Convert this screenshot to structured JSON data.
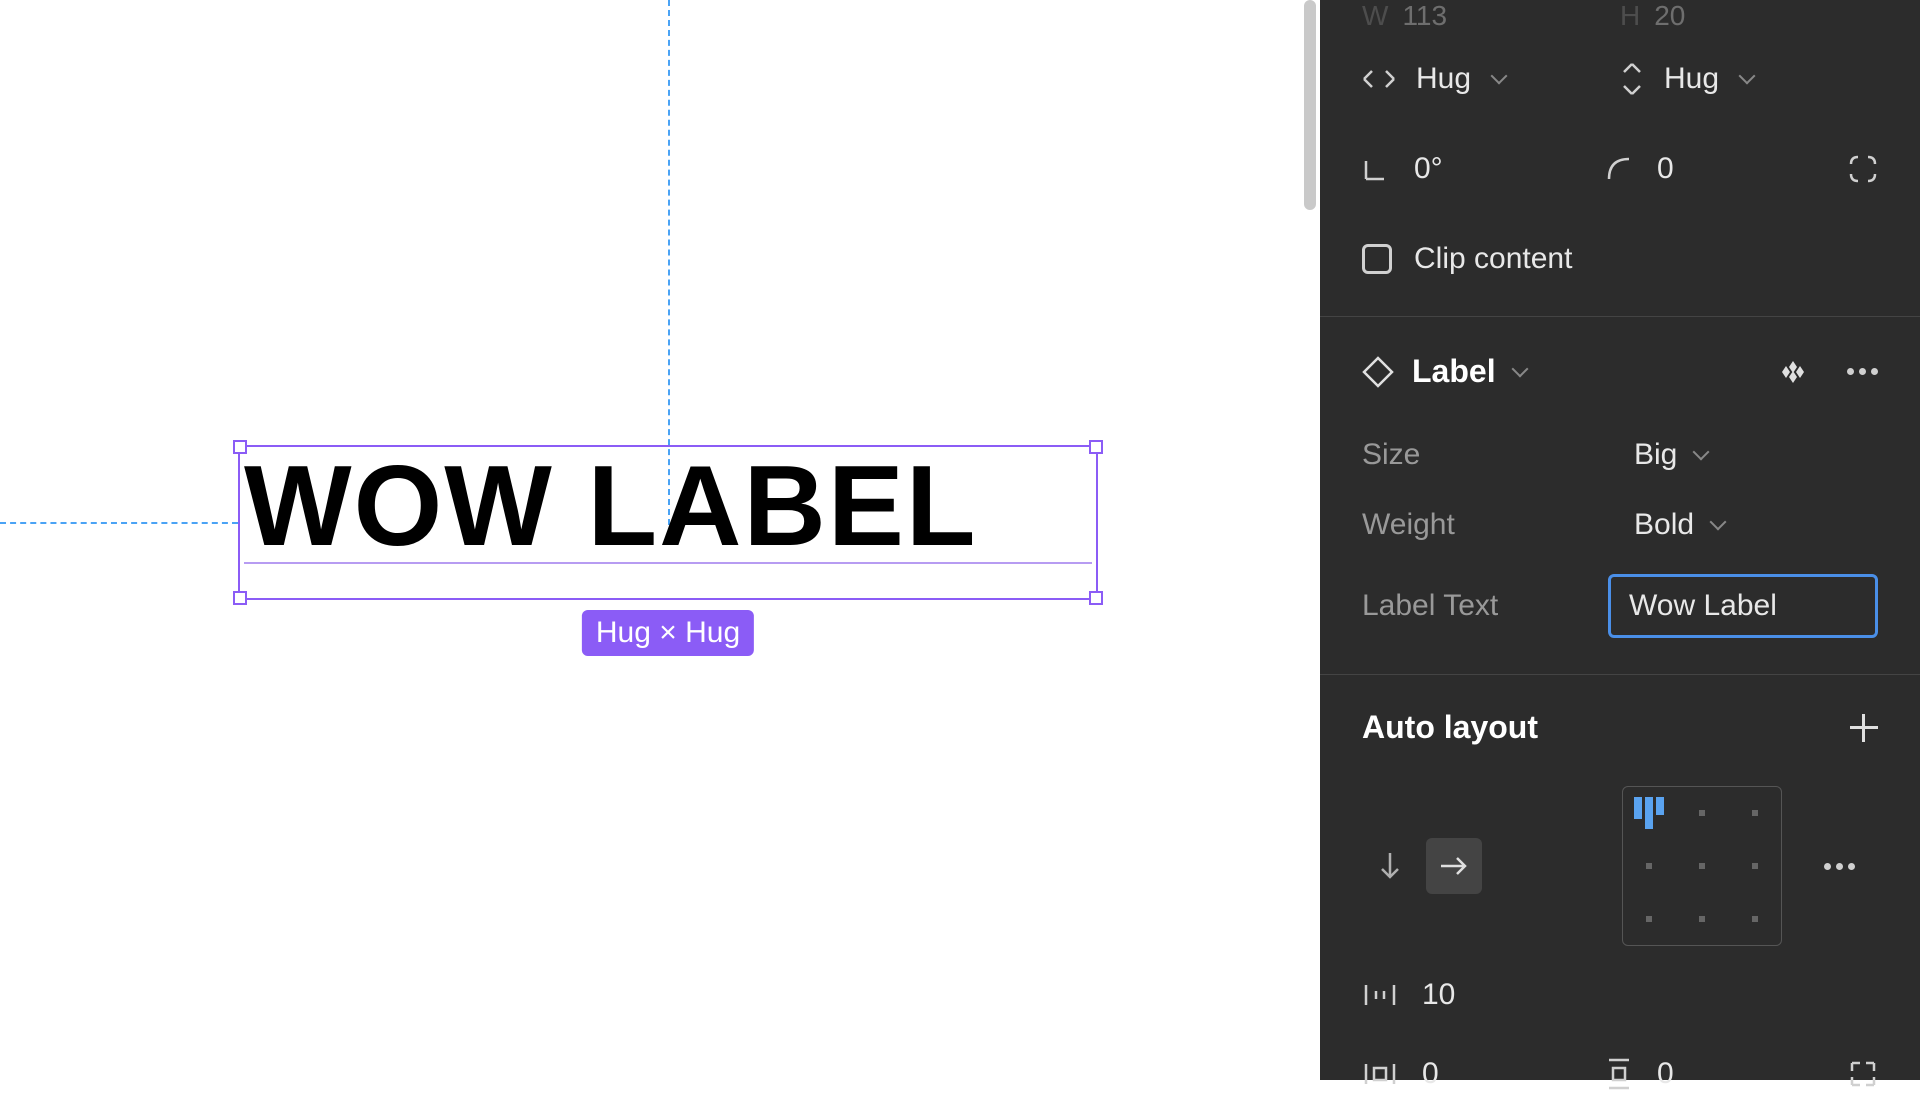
{
  "canvas": {
    "text": "WOW LABEL",
    "selection_badge": "Hug × Hug"
  },
  "dimensions": {
    "w_label": "W",
    "w_value": "113",
    "h_label": "H",
    "h_value": "20"
  },
  "resize": {
    "horizontal": "Hug",
    "vertical": "Hug"
  },
  "transform": {
    "rotation": "0°",
    "corner_radius": "0"
  },
  "clip": {
    "label": "Clip content"
  },
  "component": {
    "name": "Label",
    "props": {
      "size_label": "Size",
      "size_value": "Big",
      "weight_label": "Weight",
      "weight_value": "Bold",
      "text_label": "Label Text",
      "text_value": "Wow Label"
    }
  },
  "autolayout": {
    "title": "Auto layout",
    "gap": "10",
    "padding_h": "0",
    "padding_v": "0"
  }
}
